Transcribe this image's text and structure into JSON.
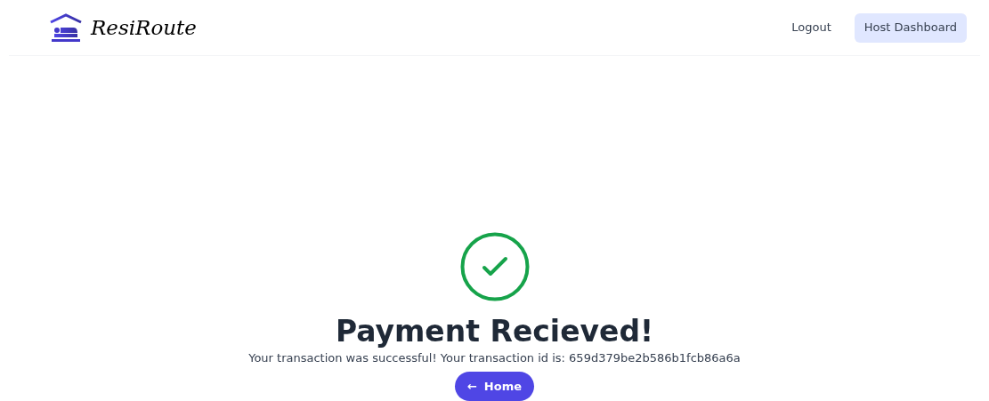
{
  "header": {
    "brand": "ResiRoute",
    "nav": [
      {
        "label": "Logout",
        "kind": "link"
      },
      {
        "label": "Host Dashboard",
        "kind": "button"
      }
    ]
  },
  "confirmation": {
    "title": "Payment Recieved!",
    "message": "Your transaction was successful! Your transaction id is: 659d379be2b586b1fcb86a6a",
    "button": {
      "arrow": "←",
      "label": "Home"
    }
  }
}
